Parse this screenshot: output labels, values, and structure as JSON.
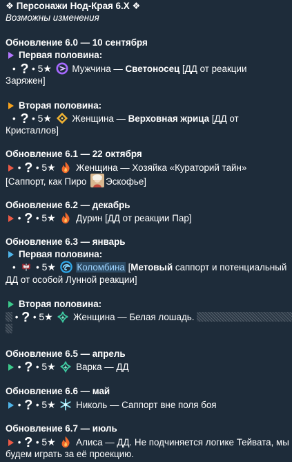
{
  "header": {
    "title": "❖ Персонажи Нод-Края 6.X ❖",
    "subtitle": "Возможны изменения"
  },
  "updates": [
    {
      "title": "Обновление 6.0 — 10 сентября",
      "halves": [
        {
          "label": "Первая половина:",
          "entry": {
            "stars": "5★",
            "desc_line1": "Мужчина — ",
            "bold": "Светоносец",
            "rest_line1": " [ДД от реакции",
            "line2": "Заряжен]"
          }
        },
        {
          "label": "Вторая половина:",
          "entry": {
            "stars": "5★",
            "desc_line1": "Женщина — ",
            "bold": "Верховная жрица",
            "rest_line1": " [ДД от",
            "line2": "Кристаллов]"
          }
        }
      ]
    },
    {
      "title": "Обновление 6.1 — 22 октября",
      "entry": {
        "stars": "5★",
        "line1": "Женщина — Хозяйка «Кураторий тайн»",
        "line2_pre": "[Саппорт, как Пиро ",
        "line2_post": "Эскофье]"
      }
    },
    {
      "title": "Обновление 6.2 — декабрь",
      "entry": {
        "stars": "5★",
        "line1": "Дурин [ДД от реакции Пар]"
      }
    },
    {
      "title": "Обновление 6.3 — январь",
      "halves": [
        {
          "label": "Первая половина:",
          "entry": {
            "stars": "5★",
            "link": "Коломбина",
            "pre": " [",
            "bold": "Метовый",
            "rest_line1": " саппорт и потенциальный",
            "line2": "ДД от особой Лунной реакции]"
          }
        },
        {
          "label": "Вторая половина:",
          "entry": {
            "stars": "5★",
            "line1": "Женщина — Белая лошадь."
          }
        }
      ]
    },
    {
      "title": "Обновление 6.5 — апрель",
      "entry": {
        "stars": "5★",
        "line1": "Варка — ДД"
      }
    },
    {
      "title": "Обновление 6.6 — май",
      "entry": {
        "stars": "5★",
        "line1": "Николь — Саппорт вне поля боя"
      }
    },
    {
      "title": "Обновление 6.7 — июль",
      "entry": {
        "stars": "5★",
        "line1": "Алиса — ДД. Не подчиняется логике Тейвата, мы",
        "line2": "будем играть за её проекцию."
      }
    }
  ],
  "symbols": {
    "bullet": "•",
    "question": "?"
  },
  "colors": {
    "background": "#1e2c3a",
    "text": "#ffffff",
    "link": "#9fd4ff",
    "purple_triangle": "#b377ff",
    "orange_triangle": "#f6a21e",
    "red_triangle": "#ec5a46",
    "blue_triangle": "#4fb4e8",
    "green_triangle": "#3cc98b"
  },
  "icons": {
    "electro": "electro-element-icon",
    "geo": "geo-element-icon",
    "pyro": "pyro-element-icon",
    "hydro": "hydro-element-icon",
    "anemo": "anemo-element-icon",
    "cryo": "cryo-element-icon"
  }
}
